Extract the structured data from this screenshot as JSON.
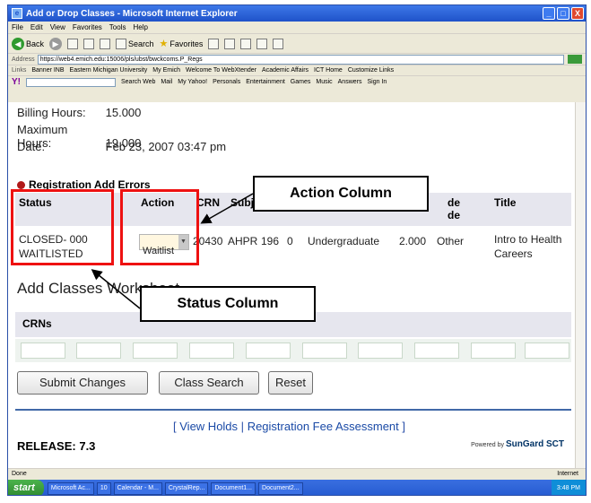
{
  "window": {
    "title": "Add or Drop Classes - Microsoft Internet Explorer",
    "controls": [
      "_",
      "□",
      "X"
    ]
  },
  "menubar": [
    "File",
    "Edit",
    "View",
    "Favorites",
    "Tools",
    "Help"
  ],
  "toolbar": {
    "back": "Back",
    "search": "Search",
    "favorites": "Favorites"
  },
  "address": {
    "label": "Address",
    "url": "https://web4.emich.edu:15006/pls/ubst/bwckcoms.P_Regs"
  },
  "links": {
    "label": "Links",
    "items": [
      "Banner INB",
      "Eastern Michigan University",
      "My Emich",
      "Welcome To WebXtender",
      "Academic Affairs",
      "ICT Home",
      "Customize Links"
    ]
  },
  "yahoo": {
    "logo": "Y!",
    "items": [
      "Search Web",
      "Mail",
      "My Yahoo!",
      "Personals",
      "Entertainment",
      "Games",
      "Music",
      "Answers",
      "Sign In"
    ]
  },
  "info": {
    "billing_label": "Billing Hours:",
    "billing_value": "15.000",
    "maximum_label": "Maximum Hours:",
    "maximum_value": "19.000",
    "date_label": "Date:",
    "date_value": "Feb 23, 2007 03:47 pm"
  },
  "errors": {
    "heading": "Registration Add Errors",
    "columns": {
      "status": "Status",
      "action": "Action",
      "crn": "CRN",
      "subj": "Subj",
      "de": "de",
      "de2": "de",
      "title": "Title"
    },
    "row": {
      "status_line1": "CLOSED- 000",
      "status_line2": "WAITLISTED",
      "action": "Waitlist",
      "crn": "20430",
      "subj": "AHPR",
      "crse": "196",
      "sec": "0",
      "level": "Undergraduate",
      "credit": "2.000",
      "grade_mode": "Other",
      "title_line1": "Intro to Health",
      "title_line2": "Careers"
    }
  },
  "worksheet": {
    "heading": "Add Classes Worksheet",
    "crns_label": "CRNs"
  },
  "buttons": {
    "submit": "Submit Changes",
    "class_search": "Class Search",
    "reset": "Reset"
  },
  "footer": {
    "open_bracket": "[",
    "view_holds": "View Holds",
    "separator": "|",
    "fee_assessment": "Registration Fee Assessment",
    "close_bracket": "]",
    "release": "RELEASE: 7.3",
    "powered_by": "Powered by",
    "sungard": "SunGard SCT"
  },
  "statusbar": {
    "left": "Done",
    "right": "Internet"
  },
  "taskbar": {
    "start": "start",
    "tasks": [
      "Microsoft Ac...",
      "10",
      "Calendar - M...",
      "CrystalRep...",
      "Document1...",
      "Document2..."
    ],
    "clock": "3:48 PM"
  },
  "annotations": {
    "action_callout": "Action Column",
    "status_callout": "Status Column",
    "highlight_color": "#ee1111"
  }
}
